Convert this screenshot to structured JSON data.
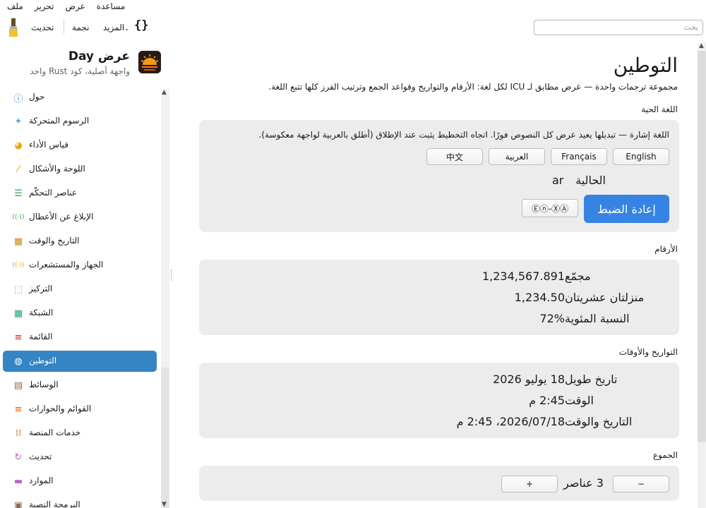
{
  "menubar": {
    "items": [
      "ملف",
      "تحرير",
      "عرض",
      "مساعدة"
    ]
  },
  "toolbar": {
    "refresh": "تحديث",
    "star": "نجمة",
    "more": "المزيد",
    "braces": "{}",
    "search_placeholder": "بحث"
  },
  "app": {
    "title": "عرض Day",
    "subtitle": "واجهة أصلية، كود Rust واحد"
  },
  "sidebar": {
    "items": [
      {
        "label": "حول",
        "icon": "info-icon",
        "color": "#3584e4"
      },
      {
        "label": "الرسوم المتحركة",
        "icon": "sparkle-icon",
        "color": "#62a0ea"
      },
      {
        "label": "قياس الأداء",
        "icon": "gauge-icon",
        "color": "#f6a000"
      },
      {
        "label": "اللوحة والأشكال",
        "icon": "brush-icon",
        "color": "#f6a000"
      },
      {
        "label": "عناصر التحكّم",
        "icon": "sliders-icon",
        "color": "#33a852"
      },
      {
        "label": "الإبلاغ عن الأعطال",
        "icon": "broadcast-icon",
        "color": "#33a852"
      },
      {
        "label": "التاريخ والوقت",
        "icon": "calendar-icon",
        "color": "#c88a00"
      },
      {
        "label": "الجهاز والمستشعرات",
        "icon": "sensor-icon",
        "color": "#e5a50a"
      },
      {
        "label": "التركيز",
        "icon": "focus-icon",
        "color": "#2ec27e"
      },
      {
        "label": "الشبكة",
        "icon": "grid-icon",
        "color": "#26a269"
      },
      {
        "label": "القائمة",
        "icon": "list-icon",
        "color": "#e01b24"
      },
      {
        "label": "التوطين",
        "icon": "globe-icon",
        "color": "#ffffff"
      },
      {
        "label": "الوسائط",
        "icon": "clapper-icon",
        "color": "#8a6d4e"
      },
      {
        "label": "القوائم والحوارات",
        "icon": "menu-lines-icon",
        "color": "#e66100"
      },
      {
        "label": "خدمات المنصة",
        "icon": "dots-grid-icon",
        "color": "#e66100"
      },
      {
        "label": "تحديث",
        "icon": "refresh-icon",
        "color": "#c061cb"
      },
      {
        "label": "الموارد",
        "icon": "folder-icon",
        "color": "#c061cb"
      },
      {
        "label": "البرمجة النصية",
        "icon": "script-icon",
        "color": "#8a6d4e"
      }
    ]
  },
  "main": {
    "title": "التوطين",
    "description": "مجموعة ترجمات واحدة — عرض مطابق لـ ICU لكل لغة: الأرقام والتواريخ وقواعد الجمع وترتيب الفرز كلها تتبع اللغة.",
    "live": {
      "title": "اللغة الحية",
      "note": "اللغة إشارة — تبديلها يعيد عرض كل النصوص فورًا. اتجاه التخطيط يثبت عند الإطلاق (أطلق بالعربية لواجهة معكوسة).",
      "languages": [
        "English",
        "Français",
        "العربية",
        "中文"
      ],
      "current_label": "الحالية",
      "current_value": "ar",
      "pseudo_button": "Ⓔⓝ-ⓍⒶ",
      "reset_button": "إعادة الضبط"
    },
    "numbers": {
      "title": "الأرقام",
      "rows": [
        {
          "label": "مجمّع",
          "value": "1,234,567.891"
        },
        {
          "label": "منزلتان عشريتان",
          "value": "1,234.50"
        },
        {
          "label": "النسبة المئوية",
          "value": "72%"
        }
      ]
    },
    "dates": {
      "title": "التواريخ والأوقات",
      "rows": [
        {
          "label": "تاريخ طويل",
          "value": "18 يوليو 2026"
        },
        {
          "label": "الوقت",
          "value": "2:45 م"
        },
        {
          "label": "التاريخ والوقت",
          "value": "2026/07/18، 2:45 م"
        }
      ]
    },
    "plurals": {
      "title": "الجموع",
      "count_text": "3 عناصر",
      "minus": "−",
      "plus": "+"
    }
  }
}
